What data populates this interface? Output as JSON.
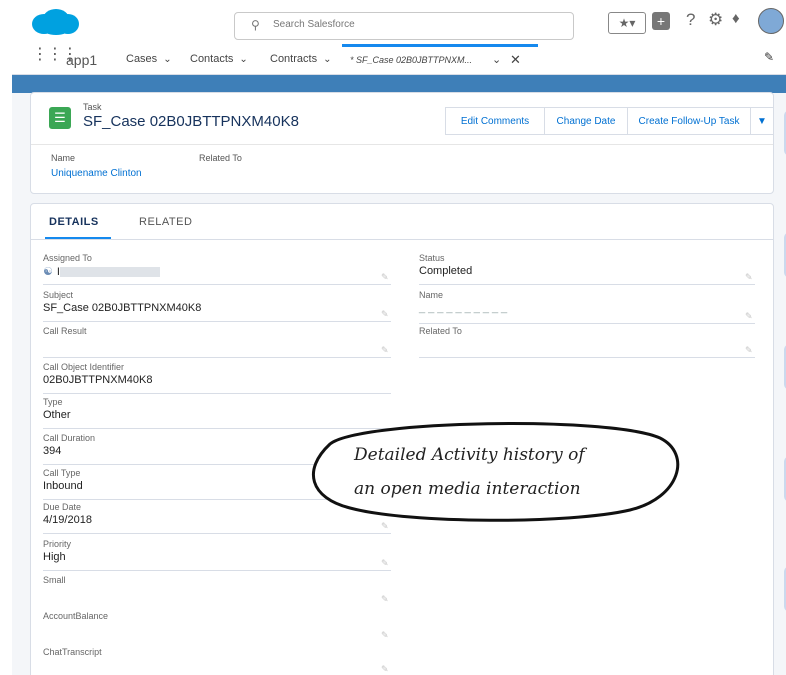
{
  "header": {
    "search_placeholder": "Search Salesforce",
    "search_icon": "search-icon",
    "icons": [
      "favorites-icon",
      "add-icon",
      "help-icon",
      "setup-gear-icon",
      "notifications-bell-icon",
      "avatar-icon"
    ]
  },
  "nav": {
    "app_name": "app1",
    "tabs": [
      {
        "label": "Cases"
      },
      {
        "label": "Contacts"
      },
      {
        "label": "Contracts"
      }
    ],
    "active_tab": {
      "label": "* SF_Case 02B0JBTTPNXM..."
    }
  },
  "record": {
    "object_label": "Task",
    "title": "SF_Case 02B0JBTTPNXM40K8",
    "actions": [
      "Edit Comments",
      "Change Date",
      "Create Follow-Up Task"
    ],
    "highlights": {
      "name_label": "Name",
      "related_label": "Related To",
      "name_value": "Uniquename Clinton"
    }
  },
  "details": {
    "tabs": [
      "DETAILS",
      "RELATED"
    ],
    "left_fields": [
      {
        "label": "Assigned To",
        "value": "I"
      },
      {
        "label": "Subject",
        "value": "SF_Case 02B0JBTTPNXM40K8"
      },
      {
        "label": "Call Result",
        "value": ""
      },
      {
        "label": "Call Object Identifier",
        "value": "02B0JBTTPNXM40K8"
      },
      {
        "label": "Type",
        "value": "Other"
      },
      {
        "label": "Call Duration",
        "value": "394"
      },
      {
        "label": "Call Type",
        "value": "Inbound"
      },
      {
        "label": "Due Date",
        "value": "4/19/2018"
      },
      {
        "label": "Priority",
        "value": "High"
      },
      {
        "label": "Small",
        "value": ""
      },
      {
        "label": "AccountBalance",
        "value": ""
      },
      {
        "label": "ChatTranscript",
        "value": ""
      }
    ],
    "right_fields": [
      {
        "label": "Status",
        "value": "Completed"
      },
      {
        "label": "Name",
        "value": ""
      },
      {
        "label": "Related To",
        "value": ""
      }
    ]
  },
  "callout": {
    "line1": "Detailed Activity history of",
    "line2": "an open media interaction"
  },
  "colors": {
    "brand_blue": "#0070d2",
    "task_green": "#3ba755",
    "active_tab_blue": "#1589ee"
  }
}
